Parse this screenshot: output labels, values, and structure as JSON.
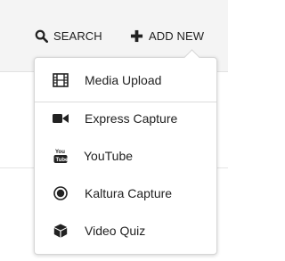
{
  "toolbar": {
    "search": {
      "label": "SEARCH",
      "icon": "search-icon"
    },
    "add_new": {
      "label": "ADD NEW",
      "icon": "plus-icon"
    }
  },
  "menu": {
    "items": [
      {
        "label": "Media Upload",
        "icon": "film-icon"
      },
      {
        "label": "Express Capture",
        "icon": "video-camera-icon"
      },
      {
        "label": "YouTube",
        "icon": "youtube-icon"
      },
      {
        "label": "Kaltura Capture",
        "icon": "record-icon"
      },
      {
        "label": "Video Quiz",
        "icon": "cube-icon"
      }
    ]
  },
  "colors": {
    "text": "#222222",
    "toolbar_bg": "#f4f4f4",
    "menu_border": "#d6d6d6"
  }
}
